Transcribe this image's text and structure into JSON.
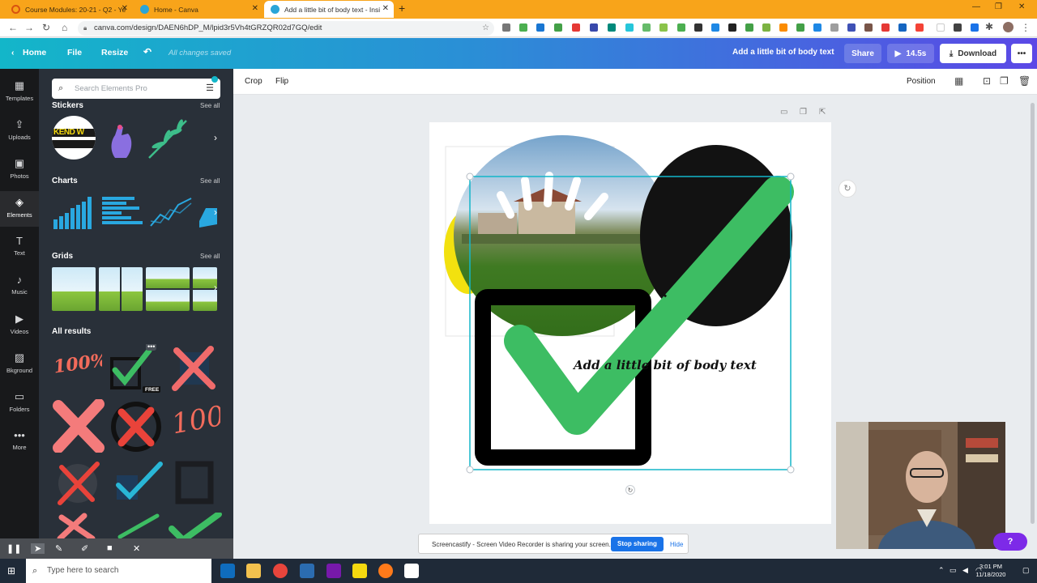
{
  "browser": {
    "tabs": [
      {
        "title": "Course Modules: 20-21 - Q2 - Ye",
        "active": false
      },
      {
        "title": "Home - Canva",
        "active": false
      },
      {
        "title": "Add a little bit of body text - Insi",
        "active": true
      }
    ],
    "url": "canva.com/design/DAEN6hDP_M/lpid3r5Vh4tGRZQR02d7GQ/edit"
  },
  "canva": {
    "home": "Home",
    "file": "File",
    "resize": "Resize",
    "saved": "All changes saved",
    "design_title": "Add a little bit of body text",
    "share": "Share",
    "duration": "14.5s",
    "download": "Download",
    "more": "•••"
  },
  "rail": [
    {
      "label": "Templates",
      "icon": "▦"
    },
    {
      "label": "Uploads",
      "icon": "⇪"
    },
    {
      "label": "Photos",
      "icon": "▣"
    },
    {
      "label": "Elements",
      "icon": "◈"
    },
    {
      "label": "Text",
      "icon": "T"
    },
    {
      "label": "Music",
      "icon": "♪"
    },
    {
      "label": "Videos",
      "icon": "▶"
    },
    {
      "label": "Bkground",
      "icon": "▨"
    },
    {
      "label": "Folders",
      "icon": "▭"
    },
    {
      "label": "More",
      "icon": "•••"
    }
  ],
  "panel": {
    "search_placeholder": "Search Elements Pro",
    "sections": [
      {
        "title": "Stickers",
        "see_all": "See all"
      },
      {
        "title": "Charts",
        "see_all": "See all"
      },
      {
        "title": "Grids",
        "see_all": "See all"
      },
      {
        "title": "All results"
      }
    ],
    "free_badge": "FREE",
    "sticker_text": "KEND W",
    "hundred_text": "100%",
    "hundred_text2": "100"
  },
  "toolbar": {
    "crop": "Crop",
    "flip": "Flip",
    "position": "Position"
  },
  "canvas": {
    "body_text": "Add a little bit of body text"
  },
  "screencastify": {
    "message": "Screencastify - Screen Video Recorder is sharing your screen.",
    "stop": "Stop sharing",
    "hide": "Hide"
  },
  "taskbar": {
    "search_placeholder": "Type here to search",
    "time": "3:01 PM",
    "date": "11/18/2020"
  },
  "help": "?",
  "colors": {
    "accent": "#13b6c9",
    "purple": "#7d2ae8",
    "check_green": "#3dbd63",
    "panel_bg": "#293039"
  }
}
